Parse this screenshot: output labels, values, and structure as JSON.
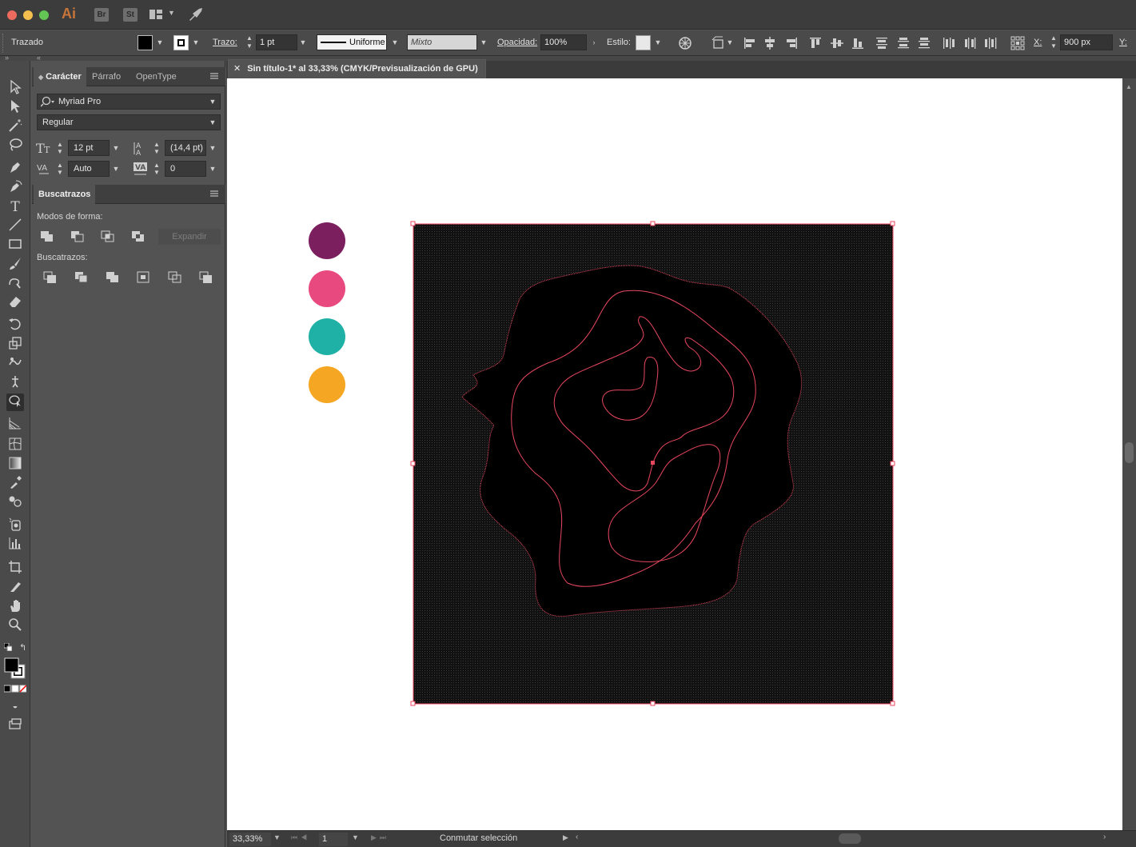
{
  "app": {
    "logo": "Ai",
    "buttons": [
      "Br",
      "St"
    ]
  },
  "control_bar": {
    "object_type": "Trazado",
    "stroke_label": "Trazo:",
    "stroke_weight": "1 pt",
    "stroke_profile": "Uniforme",
    "brush": "Mixto",
    "opacity_label": "Opacidad:",
    "opacity_value": "100%",
    "style_label": "Estilo:",
    "x_label": "X:",
    "x_value": "900 px",
    "y_label": "Y:"
  },
  "character_panel": {
    "tabs": [
      "Carácter",
      "Párrafo",
      "OpenType"
    ],
    "font_family": "Myriad Pro",
    "font_style": "Regular",
    "font_size": "12 pt",
    "leading": "(14,4 pt)",
    "kerning": "Auto",
    "tracking": "0"
  },
  "pathfinder_panel": {
    "title": "Buscatrazos",
    "shape_modes_label": "Modos de forma:",
    "expand_label": "Expandir",
    "pathfinders_label": "Buscatrazos:"
  },
  "document": {
    "tab_title": "Sin título-1* al 33,33% (CMYK/Previsualización de GPU)",
    "close_glyph": "✕",
    "swatches": [
      "#7b1f5e",
      "#e84a7f",
      "#1fb1a5",
      "#f5a623"
    ]
  },
  "status_bar": {
    "zoom": "33,33%",
    "page": "1",
    "status_text": "Conmutar selección"
  },
  "colors": {
    "selection": "#e8475f",
    "artboard_bg": "#000000"
  }
}
